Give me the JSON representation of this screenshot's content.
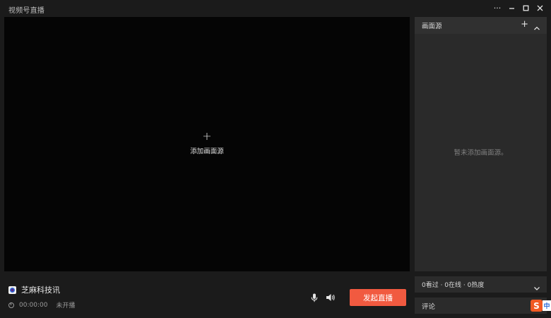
{
  "window": {
    "title": "视频号直播",
    "controls": {
      "more": "···",
      "minimize": "–",
      "maximize": "□",
      "close": "×"
    }
  },
  "preview": {
    "add_icon": "+",
    "add_label": "添加画面源",
    "background": "#050505"
  },
  "channel": {
    "name": "芝麻科技讯",
    "duration": "00:00:00",
    "status": "未开播"
  },
  "controls": {
    "mic_icon": "microphone-icon",
    "speaker_icon": "speaker-icon",
    "go_live_label": "发起直播",
    "go_live_color": "#f15a40"
  },
  "sources_panel": {
    "title": "画面源",
    "add_icon": "+",
    "empty_text": "暂未添加画面源。"
  },
  "stats": {
    "text": "0看过 · 0在线 · 0热度"
  },
  "comments": {
    "label": "评论"
  },
  "ime": {
    "badge": "S",
    "text": "中"
  }
}
